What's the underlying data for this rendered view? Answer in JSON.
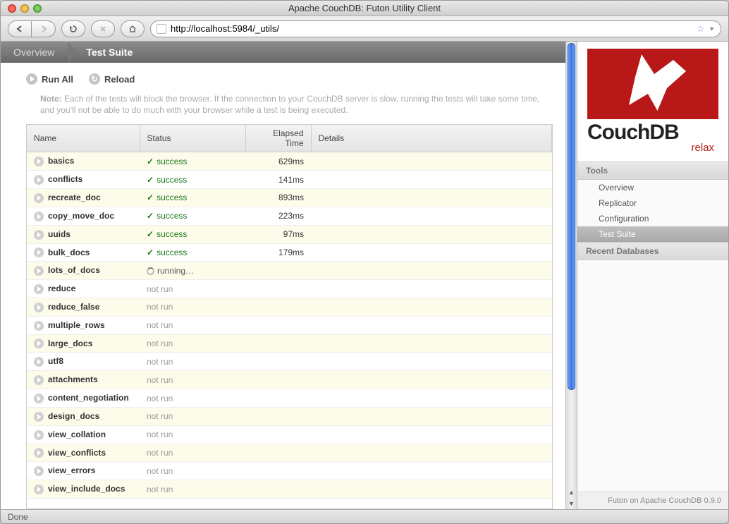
{
  "window": {
    "title": "Apache CouchDB: Futon Utility Client",
    "url": "http://localhost:5984/_utils/",
    "status": "Done"
  },
  "breadcrumb": {
    "overview": "Overview",
    "current": "Test Suite"
  },
  "actions": {
    "run_all": "Run All",
    "reload": "Reload"
  },
  "note": {
    "label": "Note:",
    "text": "Each of the tests will block the browser. If the connection to your CouchDB server is slow, running the tests will take some time, and you'll not be able to do much with your browser while a test is being executed."
  },
  "columns": {
    "name": "Name",
    "status": "Status",
    "elapsed": "Elapsed Time",
    "details": "Details"
  },
  "status_labels": {
    "success": "success",
    "running": "running…",
    "not_run": "not run"
  },
  "tests": [
    {
      "name": "basics",
      "status": "success",
      "elapsed": "629ms"
    },
    {
      "name": "conflicts",
      "status": "success",
      "elapsed": "141ms"
    },
    {
      "name": "recreate_doc",
      "status": "success",
      "elapsed": "893ms"
    },
    {
      "name": "copy_move_doc",
      "status": "success",
      "elapsed": "223ms"
    },
    {
      "name": "uuids",
      "status": "success",
      "elapsed": "97ms"
    },
    {
      "name": "bulk_docs",
      "status": "success",
      "elapsed": "179ms"
    },
    {
      "name": "lots_of_docs",
      "status": "running",
      "elapsed": ""
    },
    {
      "name": "reduce",
      "status": "not_run",
      "elapsed": ""
    },
    {
      "name": "reduce_false",
      "status": "not_run",
      "elapsed": ""
    },
    {
      "name": "multiple_rows",
      "status": "not_run",
      "elapsed": ""
    },
    {
      "name": "large_docs",
      "status": "not_run",
      "elapsed": ""
    },
    {
      "name": "utf8",
      "status": "not_run",
      "elapsed": ""
    },
    {
      "name": "attachments",
      "status": "not_run",
      "elapsed": ""
    },
    {
      "name": "content_negotiation",
      "status": "not_run",
      "elapsed": ""
    },
    {
      "name": "design_docs",
      "status": "not_run",
      "elapsed": ""
    },
    {
      "name": "view_collation",
      "status": "not_run",
      "elapsed": ""
    },
    {
      "name": "view_conflicts",
      "status": "not_run",
      "elapsed": ""
    },
    {
      "name": "view_errors",
      "status": "not_run",
      "elapsed": ""
    },
    {
      "name": "view_include_docs",
      "status": "not_run",
      "elapsed": ""
    }
  ],
  "sidebar": {
    "logo_text": "CouchDB",
    "logo_sub": "relax",
    "tools_header": "Tools",
    "tools": [
      {
        "label": "Overview",
        "selected": false
      },
      {
        "label": "Replicator",
        "selected": false
      },
      {
        "label": "Configuration",
        "selected": false
      },
      {
        "label": "Test Suite",
        "selected": true
      }
    ],
    "recent_header": "Recent Databases",
    "footer": "Futon on Apache CouchDB 0.9.0"
  }
}
